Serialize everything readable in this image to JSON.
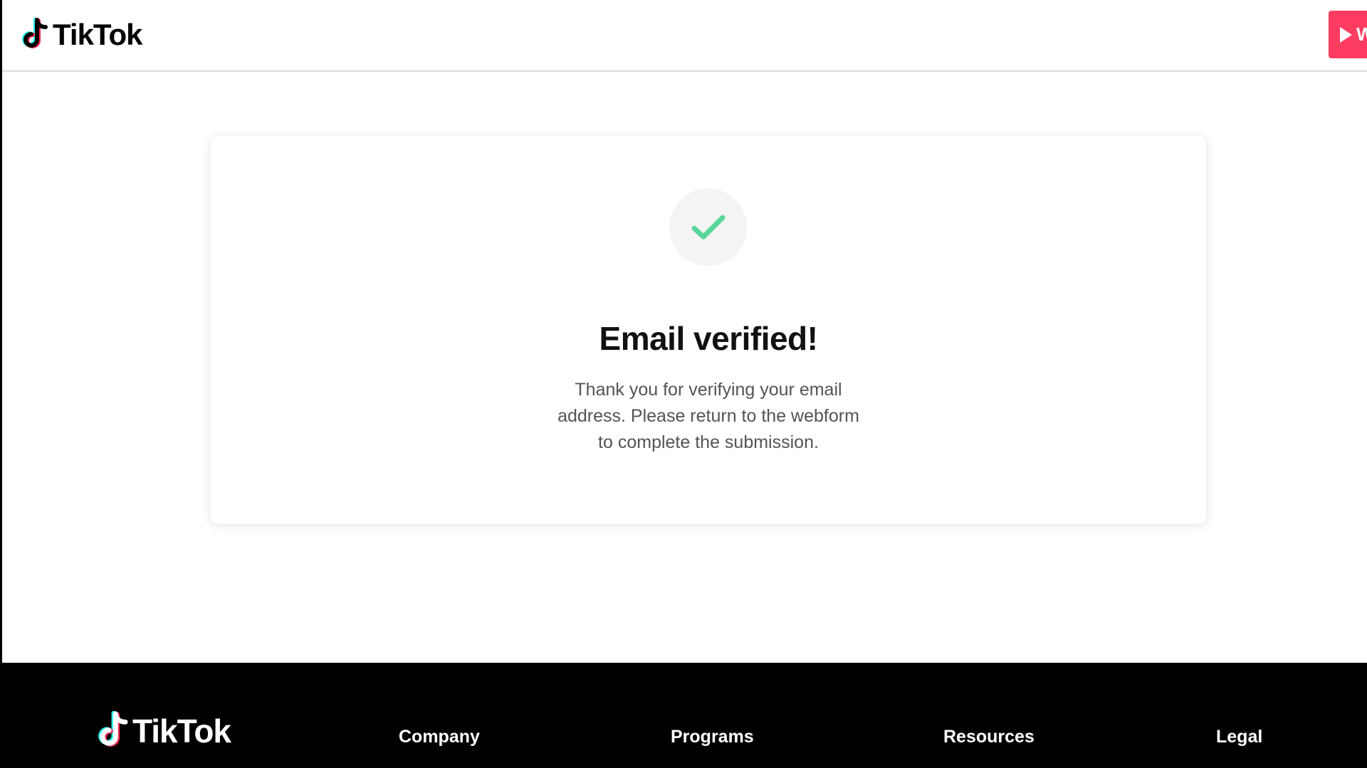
{
  "header": {
    "logo_text": "TikTok",
    "watch_button_label": "W"
  },
  "card": {
    "icon": "check-icon",
    "title": "Email verified!",
    "message": "Thank you for verifying your email address. Please return to the webform to complete the submission."
  },
  "footer": {
    "logo_text": "TikTok",
    "links": [
      "Company",
      "Programs",
      "Resources",
      "Legal"
    ]
  },
  "colors": {
    "brand_red": "#fe2c55",
    "brand_cyan": "#25f4ee",
    "check_green": "#5ad59a",
    "footer_bg": "#000000"
  }
}
